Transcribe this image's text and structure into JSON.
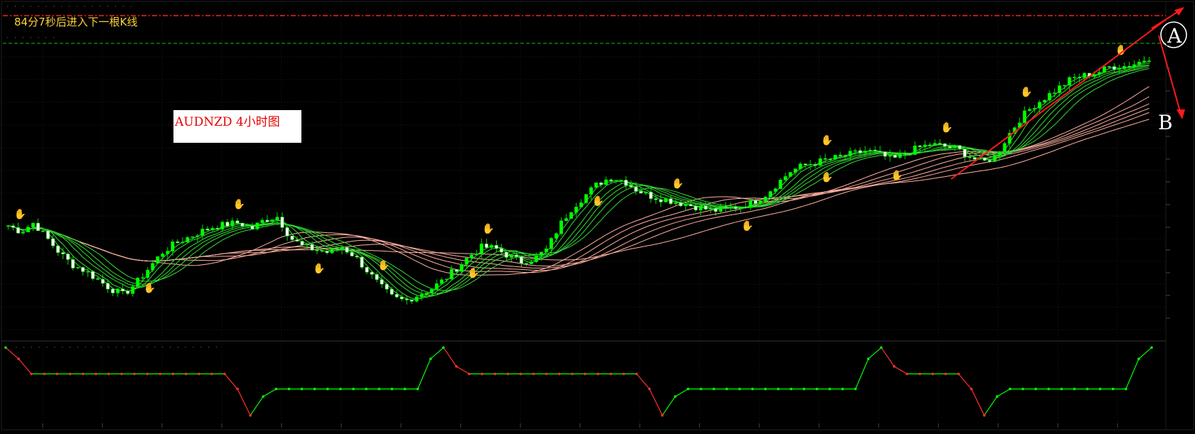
{
  "header": {
    "countdown_text": "84分7秒后进入下一根K线",
    "symbol_label": "AUDNZD  4小时图"
  },
  "annotations": {
    "point_a": "A",
    "point_b": "B"
  },
  "colors": {
    "bull_candle": "#00ff00",
    "bear_candle": "#ffffff",
    "fast_ma": "#33dd33",
    "slow_ma": "#ffb0a0",
    "trend_line": "#ff1a1a",
    "resistance_line": "#ff2020",
    "support_line": "#10c010",
    "osc_high": "#ff3030",
    "osc_low": "#00ff00",
    "top_fractal": "#ff3030",
    "bottom_fractal": "#3a9aff"
  },
  "chart_data": [
    {
      "type": "candlestick",
      "title": "AUDNZD  4小时图",
      "ylim": [
        1.29,
        1.342
      ],
      "close": [
        1.308,
        1.307,
        1.3085,
        1.306,
        1.3035,
        1.3015,
        1.3005,
        1.299,
        1.2975,
        1.2965,
        1.2985,
        1.301,
        1.3035,
        1.305,
        1.306,
        1.307,
        1.3078,
        1.3082,
        1.3085,
        1.3075,
        1.309,
        1.3095,
        1.306,
        1.3045,
        1.304,
        1.3035,
        1.3045,
        1.303,
        1.3005,
        1.298,
        1.296,
        1.2955,
        1.2965,
        1.2975,
        1.299,
        1.301,
        1.303,
        1.3045,
        1.3042,
        1.303,
        1.302,
        1.3025,
        1.304,
        1.308,
        1.311,
        1.313,
        1.315,
        1.316,
        1.3155,
        1.314,
        1.313,
        1.3125,
        1.312,
        1.3115,
        1.311,
        1.3105,
        1.3108,
        1.3112,
        1.3118,
        1.313,
        1.315,
        1.317,
        1.318,
        1.3185,
        1.319,
        1.3195,
        1.32,
        1.3205,
        1.3198,
        1.319,
        1.32,
        1.321,
        1.3215,
        1.3212,
        1.3208,
        1.3195,
        1.3185,
        1.3195,
        1.323,
        1.326,
        1.328,
        1.3295,
        1.331,
        1.3325,
        1.333,
        1.3335,
        1.3345,
        1.3345,
        1.335,
        1.336
      ],
      "moving_averages": [
        "fast ribbon (green)",
        "slow ribbon (salmon)"
      ]
    },
    {
      "type": "line",
      "ylim": [
        0,
        100
      ],
      "values": [
        95,
        80,
        60,
        60,
        60,
        60,
        60,
        60,
        60,
        60,
        60,
        60,
        60,
        60,
        60,
        60,
        60,
        60,
        40,
        5,
        30,
        40,
        40,
        40,
        40,
        40,
        40,
        40,
        40,
        40,
        40,
        40,
        40,
        80,
        95,
        70,
        60,
        60,
        60,
        60,
        60,
        60,
        60,
        60,
        60,
        60,
        60,
        60,
        60,
        60,
        40,
        5,
        30,
        40,
        40,
        40,
        40,
        40,
        40,
        40,
        40,
        40,
        40,
        40,
        40,
        40,
        40,
        80,
        95,
        70,
        60,
        60,
        60,
        60,
        60,
        40,
        5,
        30,
        40,
        40,
        40,
        40,
        40,
        40,
        40,
        40,
        40,
        40,
        80,
        95
      ],
      "markers": [
        "red dots = falling",
        "green dots = rising"
      ]
    }
  ]
}
